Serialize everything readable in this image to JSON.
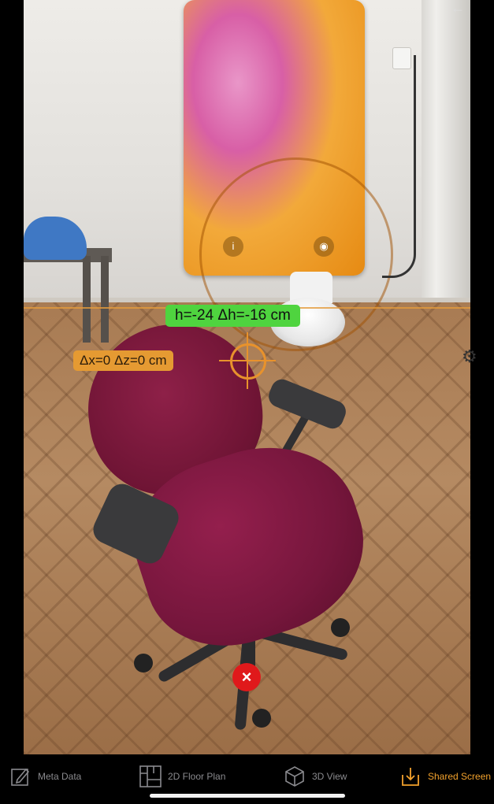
{
  "ar_view": {
    "height_label": "h=-24 Δh=-16 cm",
    "offset_label": "Δx=0 Δz=0 cm",
    "remove_symbol": "×"
  },
  "tabbar": {
    "tabs": [
      {
        "label": "Meta Data",
        "icon": "pencil-icon"
      },
      {
        "label": "2D Floor Plan",
        "icon": "floor-plan-icon"
      },
      {
        "label": "3D View",
        "icon": "cube-icon"
      },
      {
        "label": "Shared Screen",
        "icon": "download-tray-icon",
        "active": true
      }
    ]
  },
  "colors": {
    "accent": "#f2a12c",
    "inactive": "#8a8a8e",
    "height_label_bg": "#4fd43f",
    "offset_label_bg": "#e59a32",
    "remove_button": "#e0191b"
  }
}
